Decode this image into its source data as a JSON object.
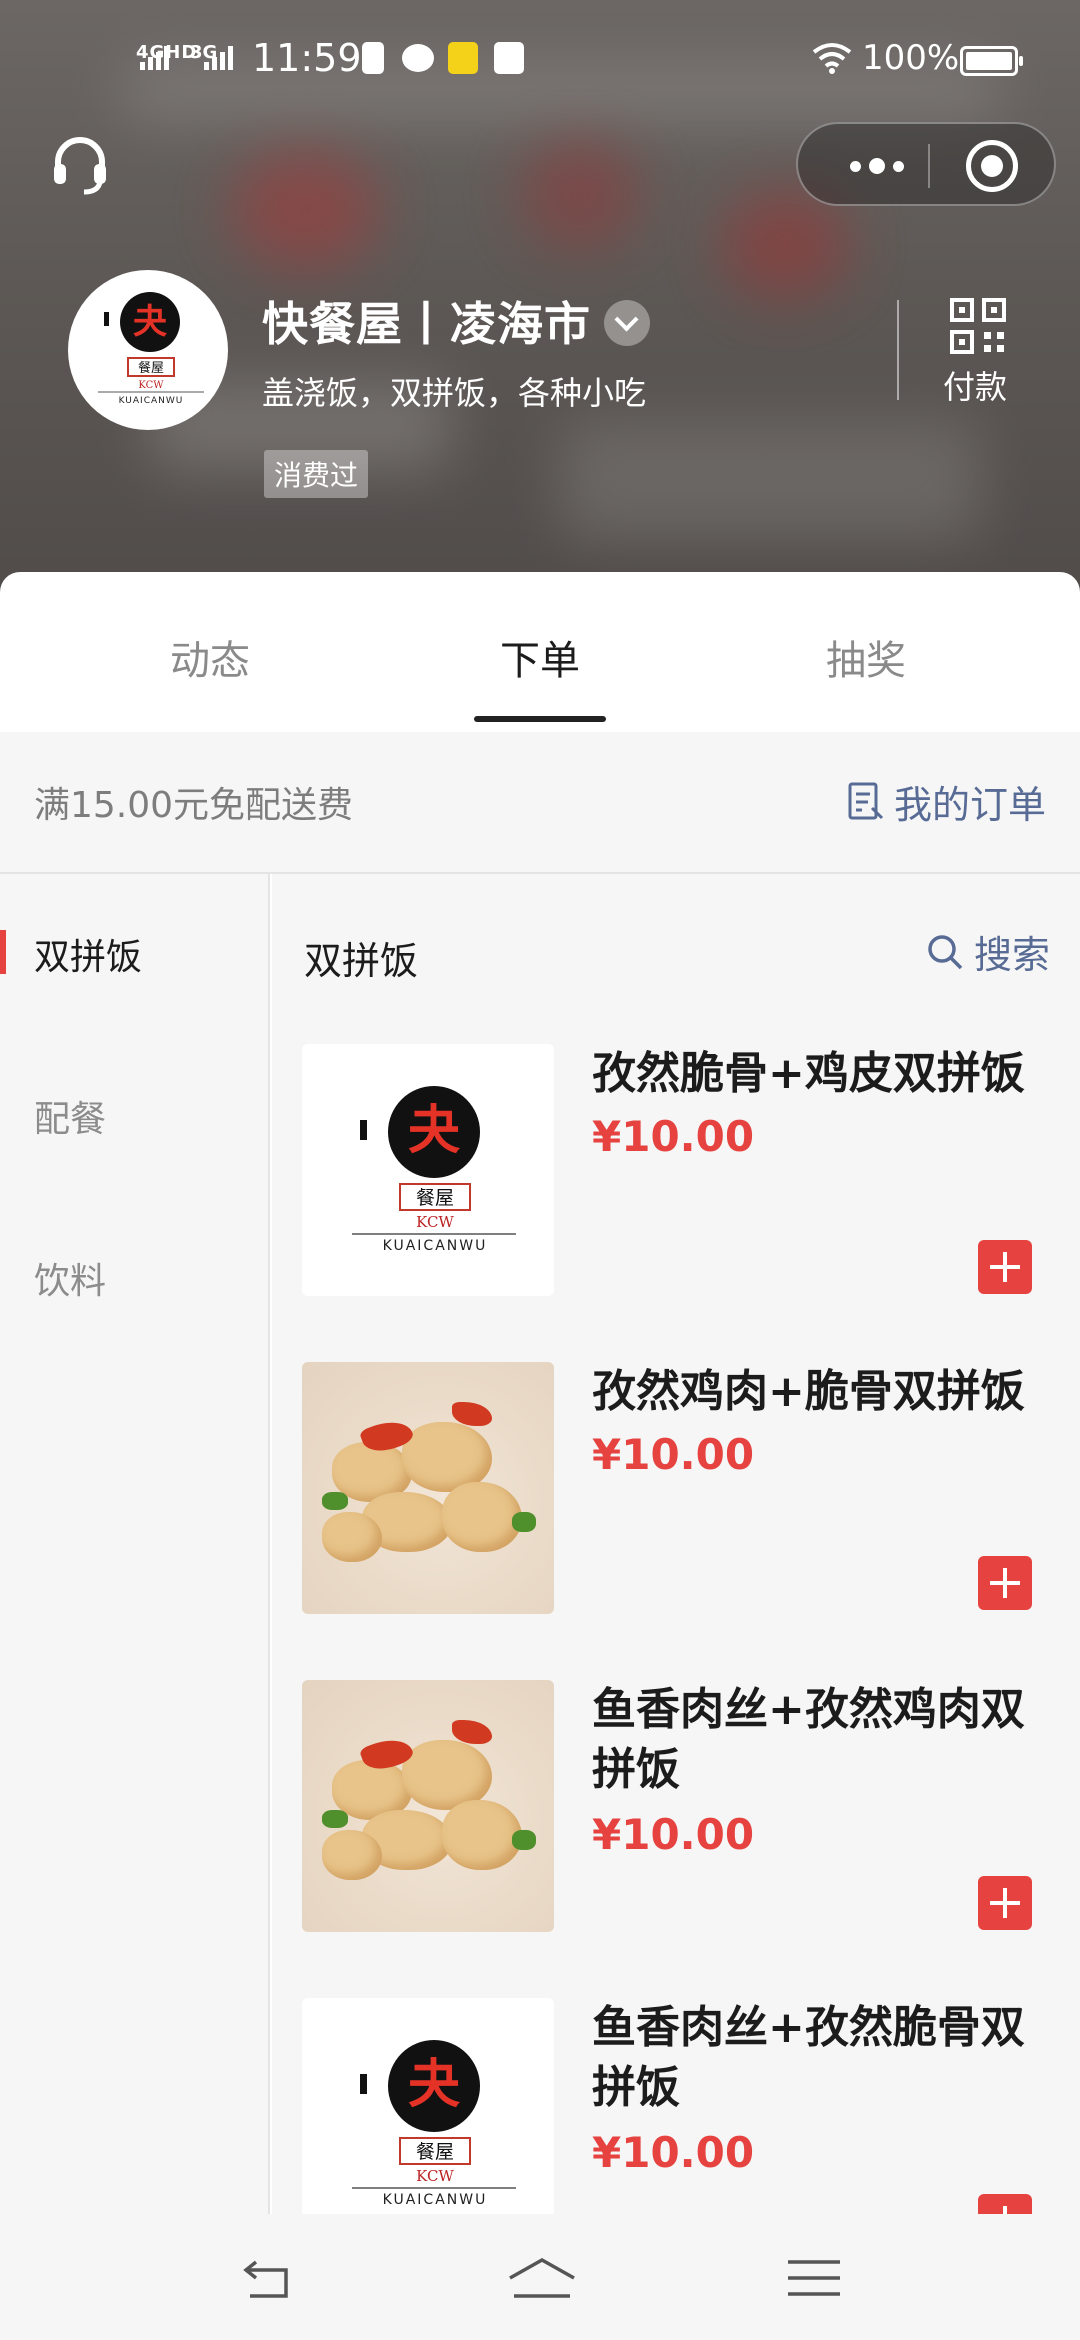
{
  "status_bar": {
    "network_left": "4GHD",
    "network_right": "3G",
    "time": "11:59",
    "battery": "100%"
  },
  "shop": {
    "name": "快餐屋丨凌海市",
    "description": "盖浇饭，双拼饭，各种小吃",
    "badge": "消费过",
    "pay_label": "付款",
    "logo": {
      "brand_mark": "餐屋",
      "code": "KCW",
      "wordmark": "KUAICANWU"
    }
  },
  "tabs": [
    {
      "label": "动态",
      "active": false
    },
    {
      "label": "下单",
      "active": true
    },
    {
      "label": "抽奖",
      "active": false
    }
  ],
  "notice": {
    "text": "满15.00元免配送费",
    "my_orders": "我的订单"
  },
  "categories": [
    {
      "label": "双拼饭",
      "active": true
    },
    {
      "label": "配餐",
      "active": false
    },
    {
      "label": "饮料",
      "active": false
    }
  ],
  "section": {
    "title": "双拼饭",
    "search_label": "搜索"
  },
  "items": [
    {
      "name": "孜然脆骨+鸡皮双拼饭",
      "price": "¥10.00",
      "image": "logo"
    },
    {
      "name": "孜然鸡肉+脆骨双拼饭",
      "price": "¥10.00",
      "image": "food"
    },
    {
      "name": "鱼香肉丝+孜然鸡肉双拼饭",
      "price": "¥10.00",
      "image": "food"
    },
    {
      "name": "鱼香肉丝+孜然脆骨双拼饭",
      "price": "¥10.00",
      "image": "logo"
    }
  ],
  "colors": {
    "accent": "#e64340",
    "link": "#576b95"
  }
}
